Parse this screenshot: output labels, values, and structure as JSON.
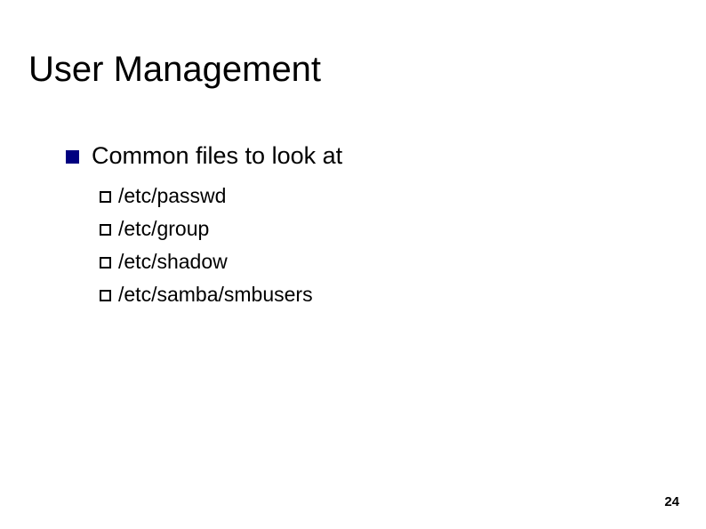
{
  "slide": {
    "title": "User Management",
    "level1_text": "Common files to look at",
    "level2_items": [
      "/etc/passwd",
      "/etc/group",
      "/etc/shadow",
      "/etc/samba/smbusers"
    ],
    "page_number": "24"
  }
}
